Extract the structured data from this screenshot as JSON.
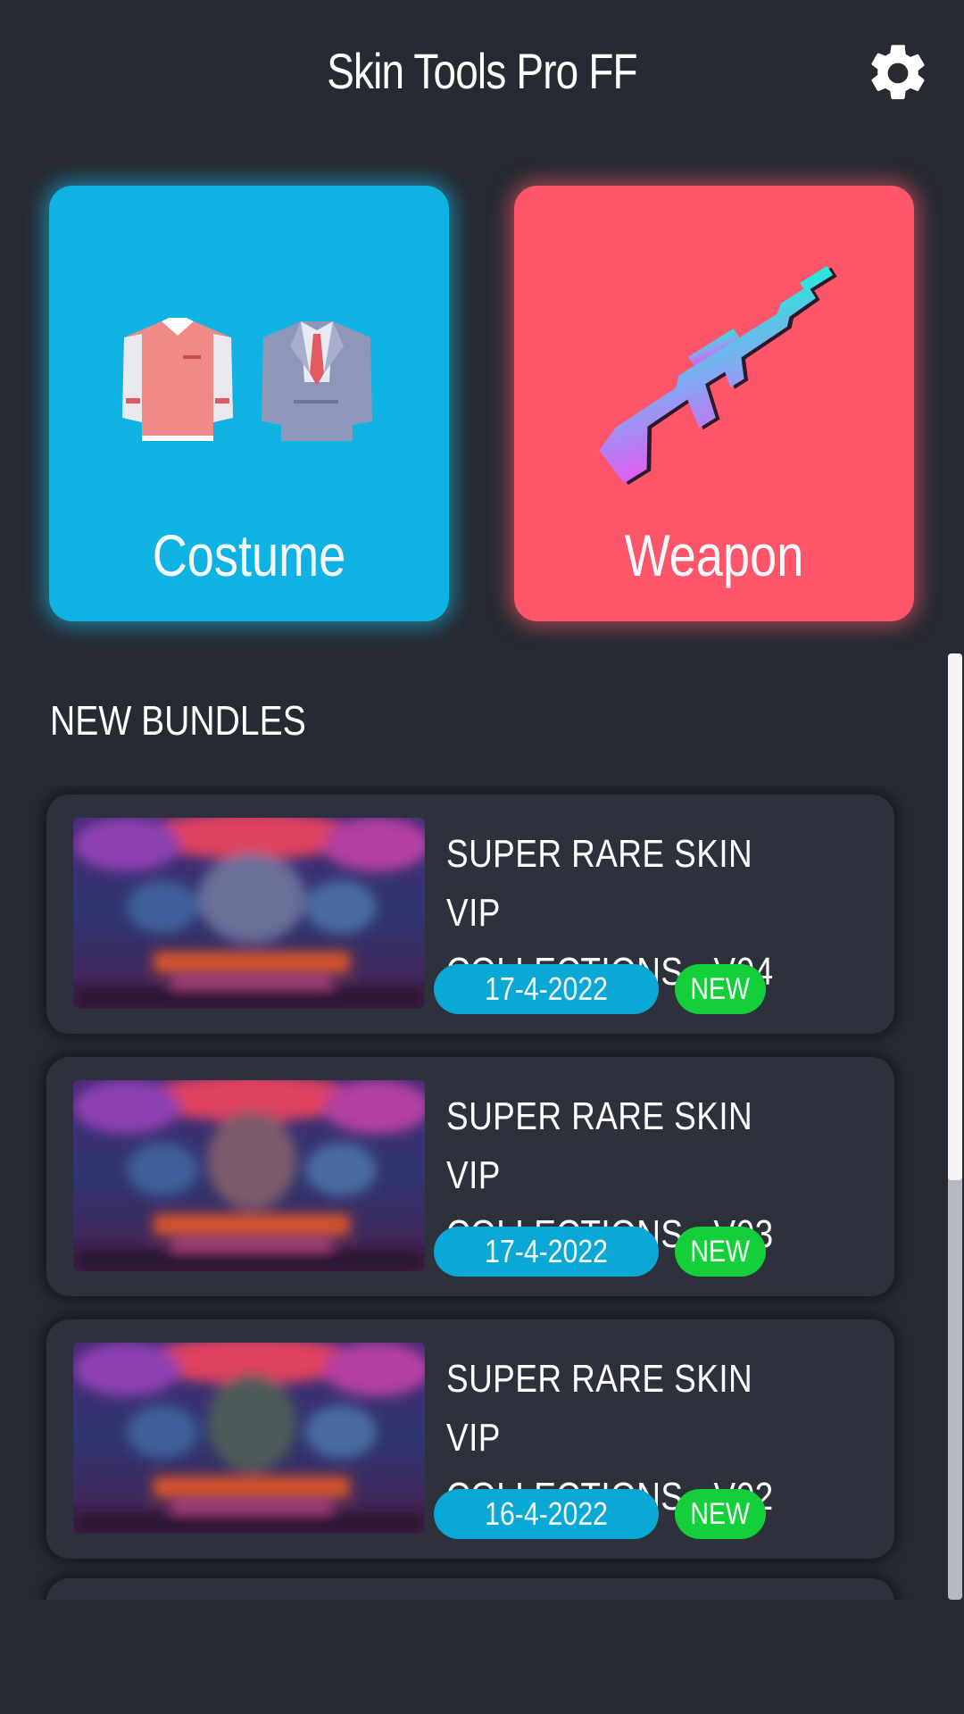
{
  "app": {
    "title": "Skin Tools Pro FF"
  },
  "header": {
    "settings_icon": "gear-icon"
  },
  "categories": [
    {
      "label": "Costume",
      "icon": "costume-icon",
      "color": "#0fb3e3"
    },
    {
      "label": "Weapon",
      "icon": "rifle-icon",
      "color": "#fd5569"
    }
  ],
  "section": {
    "title": "NEW BUNDLES"
  },
  "bundles": [
    {
      "title": "SUPER RARE SKIN VIP\nCOLLECTIONS - V04",
      "date": "17-4-2022",
      "badge": "NEW"
    },
    {
      "title": "SUPER RARE SKIN VIP\nCOLLECTIONS - V03",
      "date": "17-4-2022",
      "badge": "NEW"
    },
    {
      "title": "SUPER RARE SKIN VIP\nCOLLECTIONS - V02",
      "date": "16-4-2022",
      "badge": "NEW"
    }
  ],
  "colors": {
    "background": "#262a33",
    "card": "#2d313b",
    "date_badge": "#0ba8d6",
    "new_badge": "#15cf3a"
  }
}
